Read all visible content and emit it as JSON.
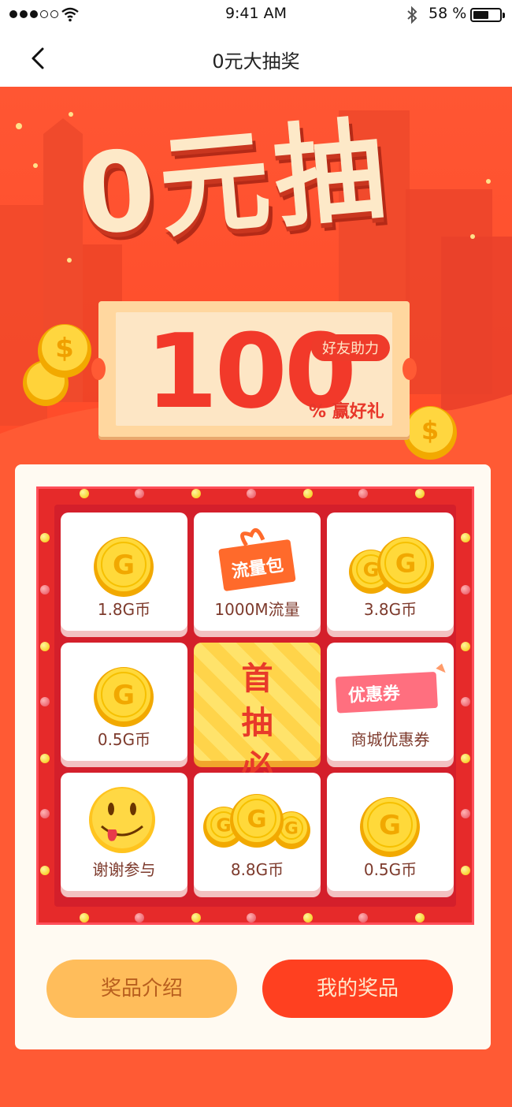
{
  "status_bar": {
    "time": "9:41 AM",
    "battery_percent": "58 %",
    "battery_level": 0.58
  },
  "nav": {
    "title": "0元大抽奖",
    "back_icon": "chevron-left-icon"
  },
  "hero": {
    "title": "0元抽",
    "big_number": "100",
    "percent_label": "% 赢好礼",
    "badge": "好友助力"
  },
  "prizes": [
    {
      "label": "1.8G币",
      "icon": "coin-icon"
    },
    {
      "label": "1000M流量",
      "icon": "data-package-icon",
      "tag": "流量包"
    },
    {
      "label": "3.8G币",
      "icon": "two-coins-icon"
    },
    {
      "label": "0.5G币",
      "icon": "coin-icon"
    },
    {
      "label": "首抽必中",
      "icon": "draw-button",
      "line1": "首 抽",
      "line2": "必 中"
    },
    {
      "label": "商城优惠券",
      "icon": "coupon-icon",
      "tag": "优惠券"
    },
    {
      "label": "谢谢参与",
      "icon": "smiley-tongue-icon"
    },
    {
      "label": "8.8G币",
      "icon": "three-coins-icon"
    },
    {
      "label": "0.5G币",
      "icon": "coin-icon"
    }
  ],
  "buttons": {
    "intro": "奖品介绍",
    "mine": "我的奖品"
  },
  "colors": {
    "brand": "#ff5a34",
    "board_red": "#e62a2a",
    "gold": "#ffd84d"
  }
}
